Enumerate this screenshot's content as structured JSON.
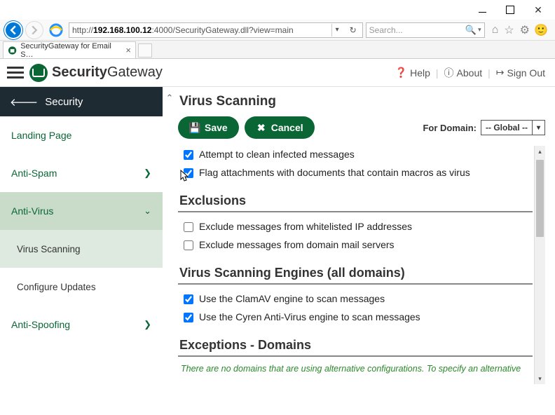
{
  "browser": {
    "url_pre": "http://",
    "url_host": "192.168.100.12",
    "url_post": ":4000/SecurityGateway.dll?view=main",
    "tab_title": "SecurityGateway for Email S…",
    "search_placeholder": "Search..."
  },
  "header": {
    "brand_bold": "Security",
    "brand_light": "Gateway",
    "help": "Help",
    "about": "About",
    "signout": "Sign Out"
  },
  "sidebar": {
    "back_label": "Security",
    "items": [
      {
        "label": "Landing Page",
        "type": "link"
      },
      {
        "label": "Anti-Spam",
        "type": "expand"
      },
      {
        "label": "Anti-Virus",
        "type": "expanded"
      },
      {
        "label": "Virus Scanning",
        "type": "sub-active"
      },
      {
        "label": "Configure Updates",
        "type": "sub"
      },
      {
        "label": "Anti-Spoofing",
        "type": "expand"
      }
    ]
  },
  "page": {
    "title": "Virus Scanning",
    "save": "Save",
    "cancel": "Cancel",
    "domain_label": "For Domain:",
    "domain_value": "-- Global --",
    "opt_clean": "Attempt to clean infected messages",
    "opt_macros": "Flag attachments with documents that contain macros as virus",
    "sec_exclusions": "Exclusions",
    "opt_excl_ip": "Exclude messages from whitelisted IP addresses",
    "opt_excl_domain": "Exclude messages from domain mail servers",
    "sec_engines": "Virus Scanning Engines (all domains)",
    "opt_clam": "Use the ClamAV engine to scan messages",
    "opt_cyren": "Use the Cyren Anti-Virus engine to scan messages",
    "sec_exceptions": "Exceptions - Domains",
    "note": "There are no domains that are using alternative configurations. To specify an alternative"
  }
}
